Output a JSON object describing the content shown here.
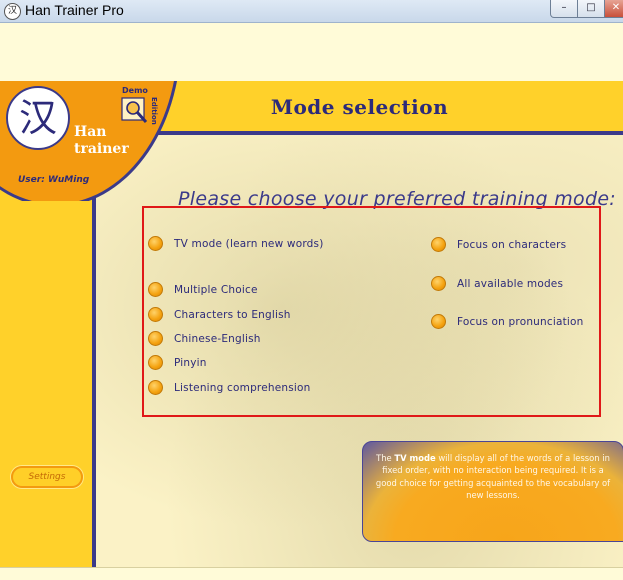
{
  "window": {
    "title": "Han Trainer Pro",
    "icon_glyph": "汉",
    "buttons": {
      "minimize": "–",
      "maximize": "□",
      "close": "✕"
    }
  },
  "logo": {
    "glyph": "汉",
    "line1": "Han",
    "line2": "trainer",
    "badge_top": "Demo",
    "badge_side": "Edition",
    "user_label": "User: WuMing"
  },
  "header": {
    "title": "Mode selection"
  },
  "prompt": "Please choose your preferred training mode:",
  "left_options": [
    {
      "label": "TV mode (learn new words)"
    },
    {
      "label": "Multiple Choice"
    },
    {
      "label": "Characters to English"
    },
    {
      "label": "Chinese-English"
    },
    {
      "label": "Pinyin"
    },
    {
      "label": "Listening comprehension"
    }
  ],
  "right_options": [
    {
      "label": "Focus on characters"
    },
    {
      "label": "All available modes"
    },
    {
      "label": "Focus on pronunciation"
    }
  ],
  "settings_label": "Settings",
  "info": {
    "prefix": "The ",
    "highlight": "TV mode",
    "text": " will display all of the words of a lesson in fixed order, with no interaction being required. It is a good choice for getting acquainted to the vocabulary of new lessons."
  },
  "colors": {
    "accent_yellow": "#ffd12a",
    "accent_orange": "#f39a10",
    "navy": "#3b3a8a",
    "selection_border": "#e01818"
  }
}
